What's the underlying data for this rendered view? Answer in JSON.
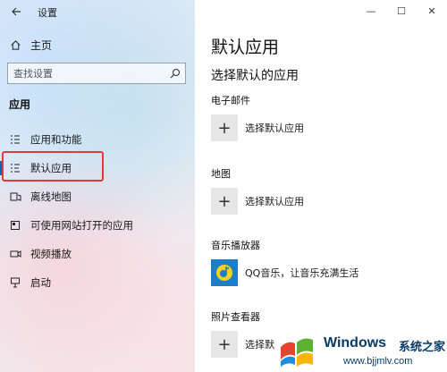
{
  "window": {
    "title": "设置",
    "controls": {
      "minimize": "—",
      "maximize": "☐",
      "close": "✕"
    }
  },
  "sidebar": {
    "back_icon": "back-arrow-icon",
    "home_label": "主页",
    "search_placeholder": "查找设置",
    "section_title": "应用",
    "items": [
      {
        "label": "应用和功能",
        "icon": "apps-features-icon"
      },
      {
        "label": "默认应用",
        "icon": "default-apps-icon",
        "selected": true
      },
      {
        "label": "离线地图",
        "icon": "offline-maps-icon"
      },
      {
        "label": "可使用网站打开的应用",
        "icon": "apps-for-websites-icon"
      },
      {
        "label": "视频播放",
        "icon": "video-playback-icon"
      },
      {
        "label": "启动",
        "icon": "startup-icon"
      }
    ]
  },
  "main": {
    "title": "默认应用",
    "subtitle": "选择默认的应用",
    "categories": [
      {
        "label": "电子邮件",
        "choice": "选择默认应用"
      },
      {
        "label": "地图",
        "choice": "选择默认应用"
      },
      {
        "label": "音乐播放器",
        "choice": "QQ音乐，让音乐充满生活"
      },
      {
        "label": "照片查看器",
        "choice": "选择默"
      }
    ]
  },
  "watermark": {
    "brand": "Windows",
    "site_name": "系统之家",
    "url": "www.bjjmlv.com"
  },
  "colors": {
    "accent": "#0067c0",
    "highlight_box": "#e03a3a",
    "qq_bg": "#1c7ec6",
    "qq_note": "#f2d21b"
  }
}
